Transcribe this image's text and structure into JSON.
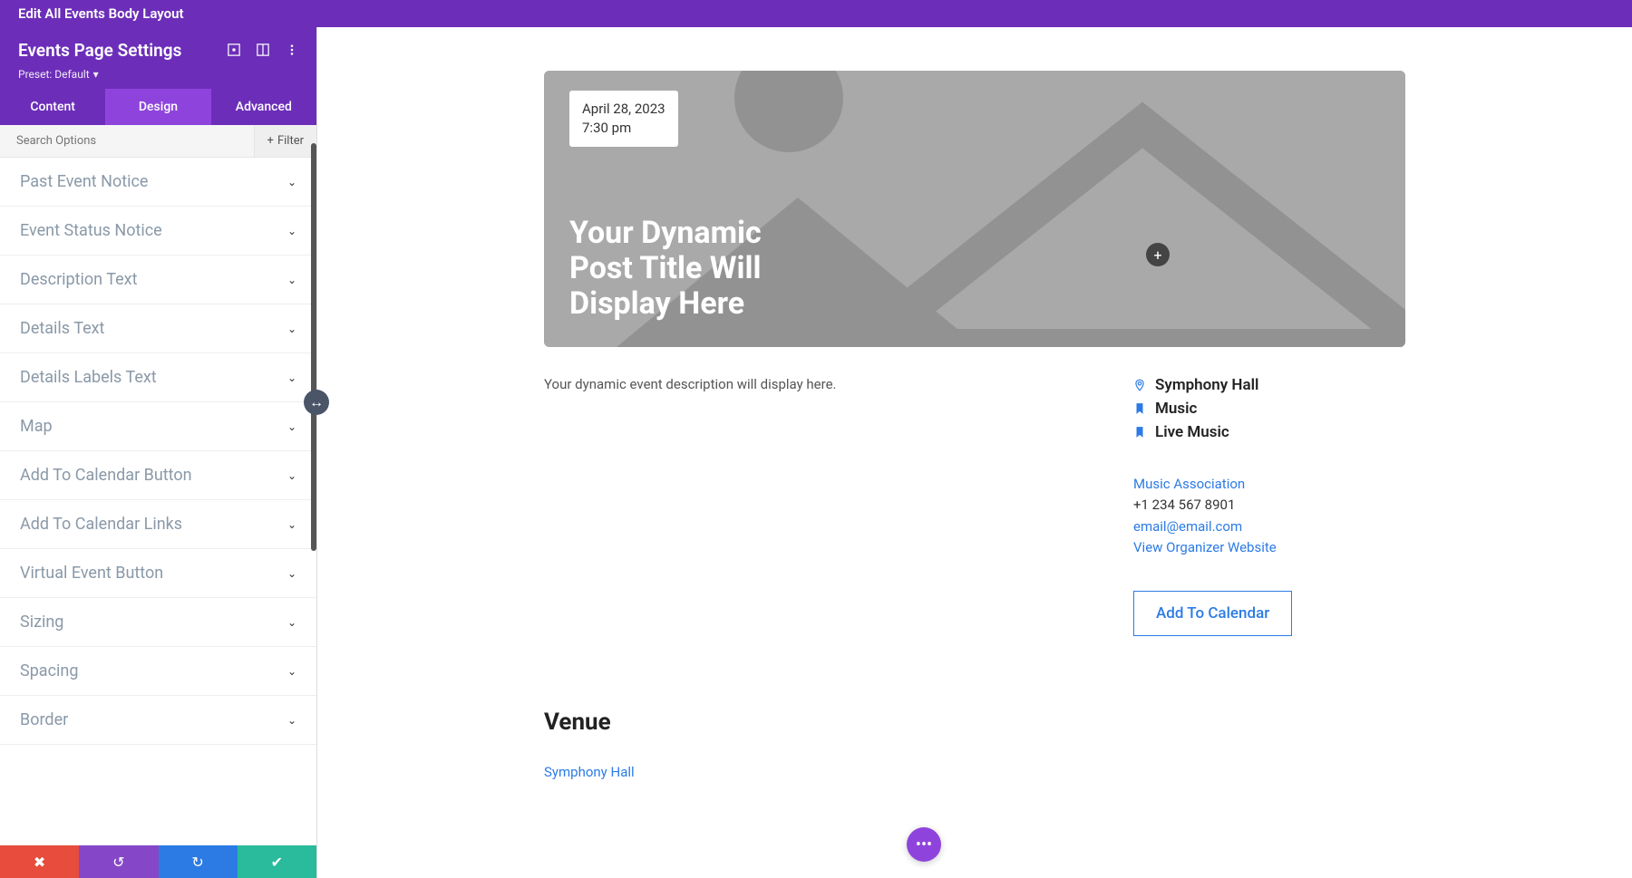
{
  "topbar": {
    "title": "Edit All Events Body Layout"
  },
  "sidebar": {
    "title": "Events Page Settings",
    "preset": "Preset: Default",
    "tabs": {
      "content": "Content",
      "design": "Design",
      "advanced": "Advanced"
    },
    "search": {
      "placeholder": "Search Options",
      "filter": "Filter"
    },
    "options": [
      "Past Event Notice",
      "Event Status Notice",
      "Description Text",
      "Details Text",
      "Details Labels Text",
      "Map",
      "Add To Calendar Button",
      "Add To Calendar Links",
      "Virtual Event Button",
      "Sizing",
      "Spacing",
      "Border"
    ]
  },
  "hero": {
    "date": "April 28, 2023",
    "time": "7:30 pm",
    "title": "Your Dynamic Post Title Will Display Here"
  },
  "body": {
    "description": "Your dynamic event description will display here.",
    "meta": {
      "venue": "Symphony Hall",
      "cat": "Music",
      "tag": "Live Music"
    },
    "org": {
      "name": "Music Association",
      "phone": "+1 234 567 8901",
      "email": "email@email.com",
      "website": "View Organizer Website"
    },
    "calendar_btn": "Add To Calendar"
  },
  "venue": {
    "heading": "Venue",
    "name": "Symphony Hall"
  }
}
